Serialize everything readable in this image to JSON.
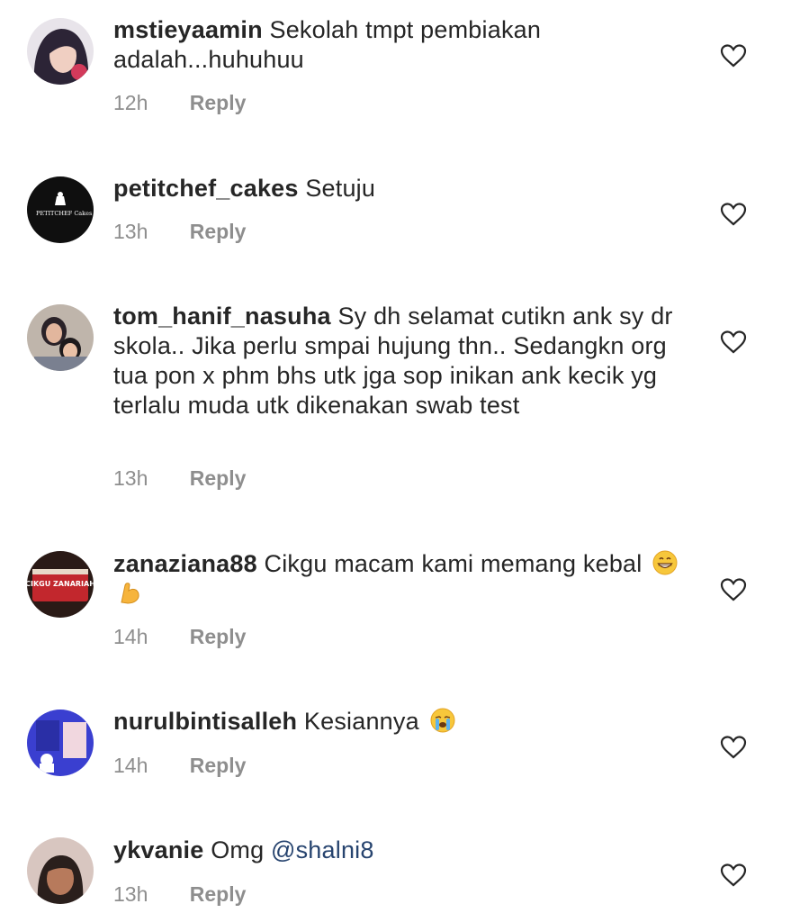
{
  "comments": [
    {
      "username": "mstieyaamin",
      "text": "Sekolah tmpt pembiakan adalah...huhuhuu",
      "time": "12h",
      "reply_label": "Reply",
      "avatar": "woman-hijab-avatar"
    },
    {
      "username": "petitchef_cakes",
      "text": "Setuju",
      "time": "13h",
      "reply_label": "Reply",
      "avatar": "petitchef-cakes-logo",
      "logo_text": "PETITCHEF Cakes"
    },
    {
      "username": "tom_hanif_nasuha",
      "text": "Sy dh selamat cutikn ank sy dr skola.. Jika perlu smpai hujung thn.. Sedangkn org tua pon x phm bhs utk jga sop inikan ank kecik yg terlalu muda utk dikenakan swab test",
      "time": "13h",
      "reply_label": "Reply",
      "avatar": "mother-child-avatar"
    },
    {
      "username": "zanaziana88",
      "text": "Cikgu macam kami memang kebal",
      "time": "14h",
      "reply_label": "Reply",
      "avatar": "cake-avatar",
      "emojis": [
        "grinning-face-emoji",
        "flexed-biceps-emoji"
      ],
      "cake_text": "CIKGU ZANARIAH"
    },
    {
      "username": "nurulbintisalleh",
      "text": "Kesiannya",
      "time": "14h",
      "reply_label": "Reply",
      "avatar": "books-avatar",
      "emojis": [
        "crying-face-emoji"
      ]
    },
    {
      "username": "ykvanie",
      "text": "Omg",
      "mention": "@shalni8",
      "time": "13h",
      "reply_label": "Reply",
      "avatar": "woman-avatar"
    }
  ],
  "icons": {
    "like": "heart-outline-icon"
  },
  "colors": {
    "meta": "#8e8e8e",
    "mention": "#27446f",
    "text": "#262626"
  }
}
